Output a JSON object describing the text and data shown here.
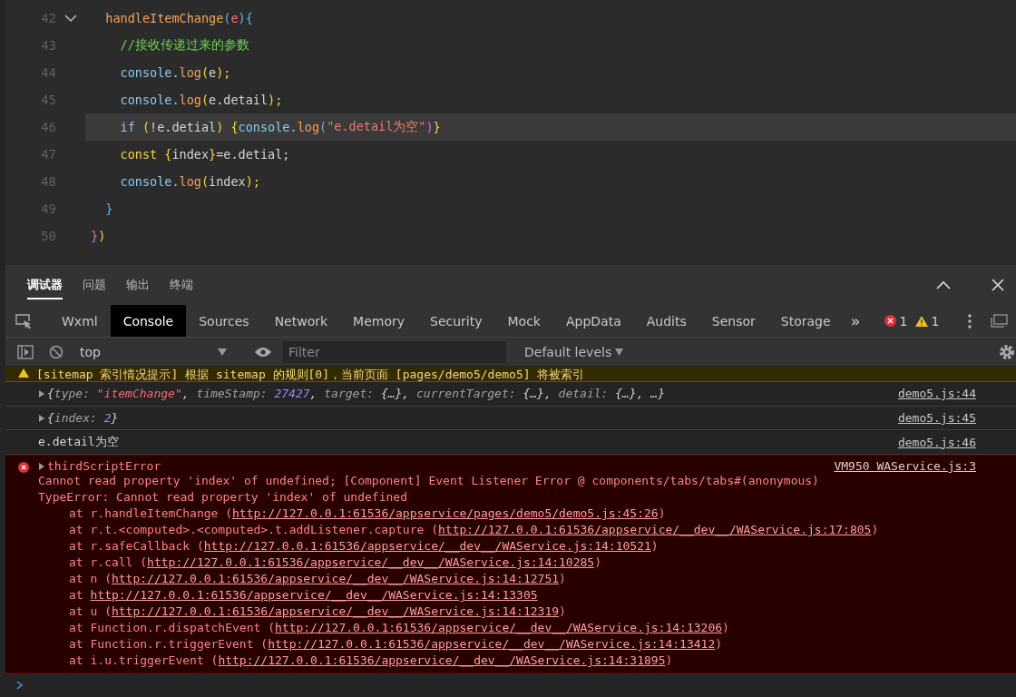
{
  "editor": {
    "lines": [
      {
        "number": "42",
        "fold": true,
        "highlighted": false,
        "tokens": [
          {
            "text": "  handleItemChange",
            "kind": "fn"
          },
          {
            "text": "(",
            "kind": "paren"
          },
          {
            "text": "e",
            "kind": "param"
          },
          {
            "text": ")",
            "kind": "paren"
          },
          {
            "text": "{",
            "kind": "brace2"
          }
        ]
      },
      {
        "number": "43",
        "fold": false,
        "highlighted": false,
        "tokens": [
          {
            "text": "    //接收传递过来的参数",
            "kind": "comment"
          }
        ]
      },
      {
        "number": "44",
        "fold": false,
        "highlighted": false,
        "tokens": [
          {
            "text": "    console.",
            "kind": "var"
          },
          {
            "text": "log",
            "kind": "fn"
          },
          {
            "text": "(",
            "kind": "brace"
          },
          {
            "text": "e",
            "kind": "plain"
          },
          {
            "text": ");",
            "kind": "brace"
          }
        ]
      },
      {
        "number": "45",
        "fold": false,
        "highlighted": false,
        "tokens": [
          {
            "text": "    console.",
            "kind": "var"
          },
          {
            "text": "log",
            "kind": "fn"
          },
          {
            "text": "(",
            "kind": "brace"
          },
          {
            "text": "e.detail",
            "kind": "plain"
          },
          {
            "text": ");",
            "kind": "brace"
          }
        ]
      },
      {
        "number": "46",
        "fold": false,
        "highlighted": true,
        "tokens": [
          {
            "text": "    if ",
            "kind": "var"
          },
          {
            "text": "(",
            "kind": "brace"
          },
          {
            "text": "!e.detial",
            "kind": "plain"
          },
          {
            "text": ") {",
            "kind": "brace"
          },
          {
            "text": "console.",
            "kind": "var"
          },
          {
            "text": "log",
            "kind": "fn"
          },
          {
            "text": "(",
            "kind": "paren"
          },
          {
            "text": "\"e.detail为空\"",
            "kind": "string"
          },
          {
            "text": ")",
            "kind": "paren2"
          },
          {
            "text": "}",
            "kind": "brace"
          }
        ]
      },
      {
        "number": "47",
        "fold": false,
        "highlighted": false,
        "tokens": [
          {
            "text": "    const ",
            "kind": "keyword"
          },
          {
            "text": "{",
            "kind": "brace"
          },
          {
            "text": "index",
            "kind": "plain"
          },
          {
            "text": "}",
            "kind": "brace"
          },
          {
            "text": "=e.detial;",
            "kind": "plain"
          }
        ]
      },
      {
        "number": "48",
        "fold": false,
        "highlighted": false,
        "tokens": [
          {
            "text": "    console.",
            "kind": "var"
          },
          {
            "text": "log",
            "kind": "fn"
          },
          {
            "text": "(",
            "kind": "brace"
          },
          {
            "text": "index",
            "kind": "plain"
          },
          {
            "text": ");",
            "kind": "brace"
          }
        ]
      },
      {
        "number": "49",
        "fold": false,
        "highlighted": false,
        "tokens": [
          {
            "text": "  }",
            "kind": "brace2"
          }
        ]
      },
      {
        "number": "50",
        "fold": false,
        "highlighted": false,
        "tokens": [
          {
            "text": "}",
            "kind": "paren2"
          },
          {
            "text": ")",
            "kind": "brace"
          }
        ]
      }
    ]
  },
  "panel_tabs": [
    {
      "label": "调试器",
      "selected": true
    },
    {
      "label": "问题",
      "selected": false
    },
    {
      "label": "输出",
      "selected": false
    },
    {
      "label": "终端",
      "selected": false
    }
  ],
  "devtools_tabs": [
    {
      "label": "Wxml",
      "selected": false
    },
    {
      "label": "Console",
      "selected": true
    },
    {
      "label": "Sources",
      "selected": false
    },
    {
      "label": "Network",
      "selected": false
    },
    {
      "label": "Memory",
      "selected": false
    },
    {
      "label": "Security",
      "selected": false
    },
    {
      "label": "Mock",
      "selected": false
    },
    {
      "label": "AppData",
      "selected": false
    },
    {
      "label": "Audits",
      "selected": false
    },
    {
      "label": "Sensor",
      "selected": false
    },
    {
      "label": "Storage",
      "selected": false
    }
  ],
  "overflow": "»",
  "error_count": "1",
  "warning_count": "1",
  "context": "top",
  "filter": {
    "placeholder": "Filter"
  },
  "levels": "Default levels",
  "messages": [
    {
      "kind": "warning",
      "text": "[sitemap 索引情况提示] 根据 sitemap 的规则[0]，当前页面 [pages/demo5/demo5] 将被索引"
    },
    {
      "kind": "object",
      "source": "demo5.js:44",
      "tokens": [
        {
          "text": "{",
          "kind": "plain"
        },
        {
          "text": "type: ",
          "kind": "key"
        },
        {
          "text": "\"itemChange\"",
          "kind": "string"
        },
        {
          "text": ", ",
          "kind": "plain"
        },
        {
          "text": "timeStamp: ",
          "kind": "key"
        },
        {
          "text": "27427",
          "kind": "number"
        },
        {
          "text": ", ",
          "kind": "plain"
        },
        {
          "text": "target: ",
          "kind": "key"
        },
        {
          "text": "{…}, ",
          "kind": "plain"
        },
        {
          "text": "currentTarget: ",
          "kind": "key"
        },
        {
          "text": "{…}, ",
          "kind": "plain"
        },
        {
          "text": "detail: ",
          "kind": "key"
        },
        {
          "text": "{…}, …}",
          "kind": "plain"
        }
      ]
    },
    {
      "kind": "object",
      "source": "demo5.js:45",
      "tokens": [
        {
          "text": "{",
          "kind": "plain"
        },
        {
          "text": "index: ",
          "kind": "key"
        },
        {
          "text": "2",
          "kind": "number"
        },
        {
          "text": "}",
          "kind": "plain"
        }
      ]
    },
    {
      "kind": "text",
      "source": "demo5.js:46",
      "text": "e.detail为空"
    },
    {
      "kind": "error",
      "source": "VM950 WAService.js:3",
      "title": "thirdScriptError",
      "lines": [
        "Cannot read property 'index' of undefined; [Component] Event Listener Error @ components/tabs/tabs#(anonymous)",
        "TypeError: Cannot read property 'index' of undefined"
      ],
      "stack": [
        {
          "prefix": "at r.handleItemChange (",
          "url": "http://127.0.0.1:61536/appservice/pages/demo5/demo5.js:45:26",
          "suffix": ")"
        },
        {
          "prefix": "at r.t.<computed>.<computed>.t.addListener.capture (",
          "url": "http://127.0.0.1:61536/appservice/__dev__/WAService.js:17:805",
          "suffix": ")"
        },
        {
          "prefix": "at r.safeCallback (",
          "url": "http://127.0.0.1:61536/appservice/__dev__/WAService.js:14:10521",
          "suffix": ")"
        },
        {
          "prefix": "at r.call (",
          "url": "http://127.0.0.1:61536/appservice/__dev__/WAService.js:14:10285",
          "suffix": ")"
        },
        {
          "prefix": "at n (",
          "url": "http://127.0.0.1:61536/appservice/__dev__/WAService.js:14:12751",
          "suffix": ")"
        },
        {
          "prefix": "at ",
          "url": "http://127.0.0.1:61536/appservice/__dev__/WAService.js:14:13305"
        },
        {
          "prefix": "at u (",
          "url": "http://127.0.0.1:61536/appservice/__dev__/WAService.js:14:12319",
          "suffix": ")"
        },
        {
          "prefix": "at Function.r.dispatchEvent (",
          "url": "http://127.0.0.1:61536/appservice/__dev__/WAService.js:14:13206",
          "suffix": ")"
        },
        {
          "prefix": "at Function.r.triggerEvent (",
          "url": "http://127.0.0.1:61536/appservice/__dev__/WAService.js:14:13412",
          "suffix": ")"
        },
        {
          "prefix": "at i.u.triggerEvent (",
          "url": "http://127.0.0.1:61536/appservice/__dev__/WAService.js:14:31895",
          "suffix": ")"
        }
      ]
    }
  ]
}
